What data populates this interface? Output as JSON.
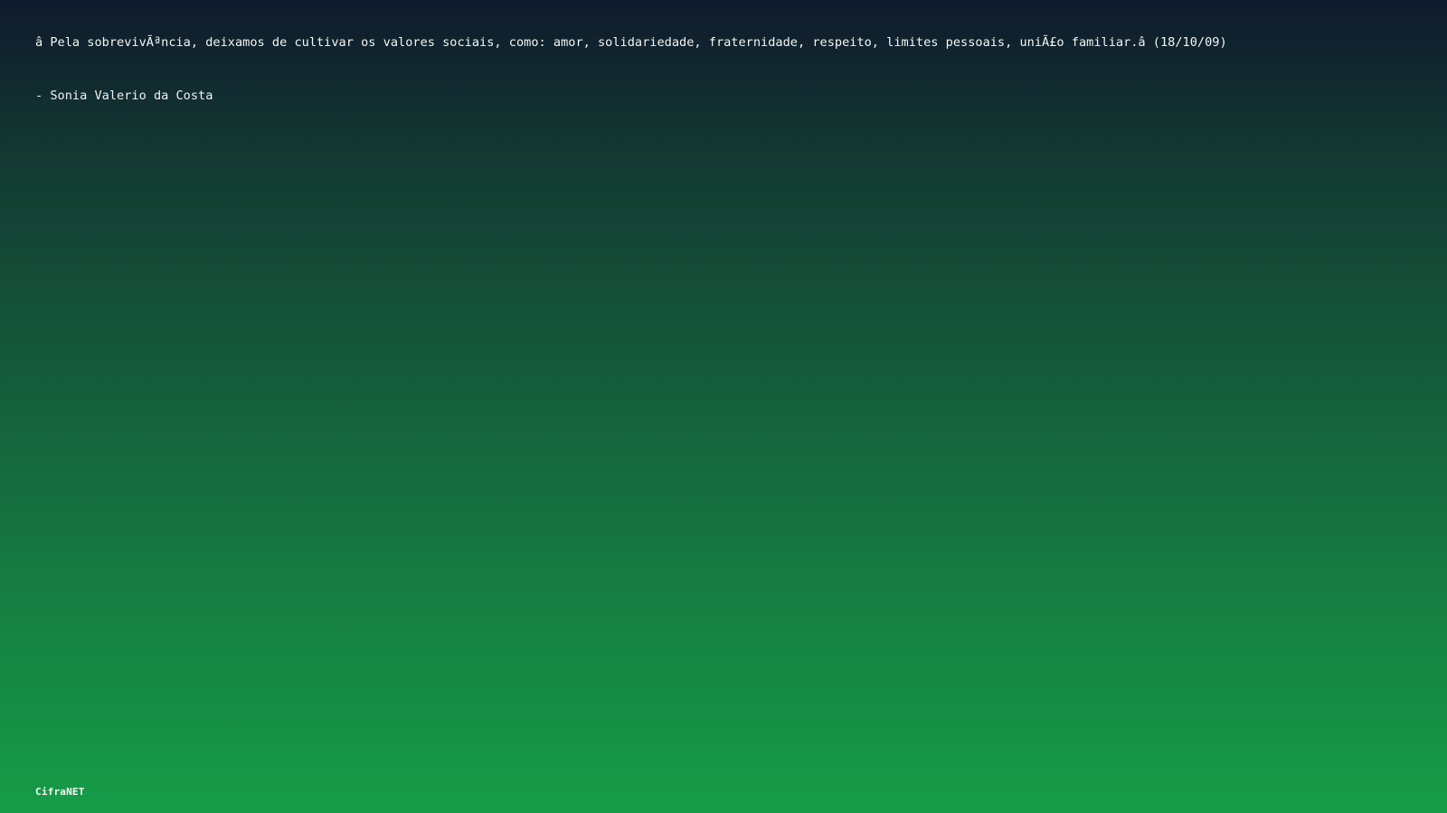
{
  "quote": {
    "text": "â  Pela sobrevivÃªncia, deixamos de cultivar os valores sociais, como: amor, solidariedade, fraternidade, respeito, limites pessoais, uniÃ£o familiar.â   (18/10/09)",
    "author": "- Sonia Valerio da Costa"
  },
  "brand": {
    "name": "CifraNET"
  }
}
